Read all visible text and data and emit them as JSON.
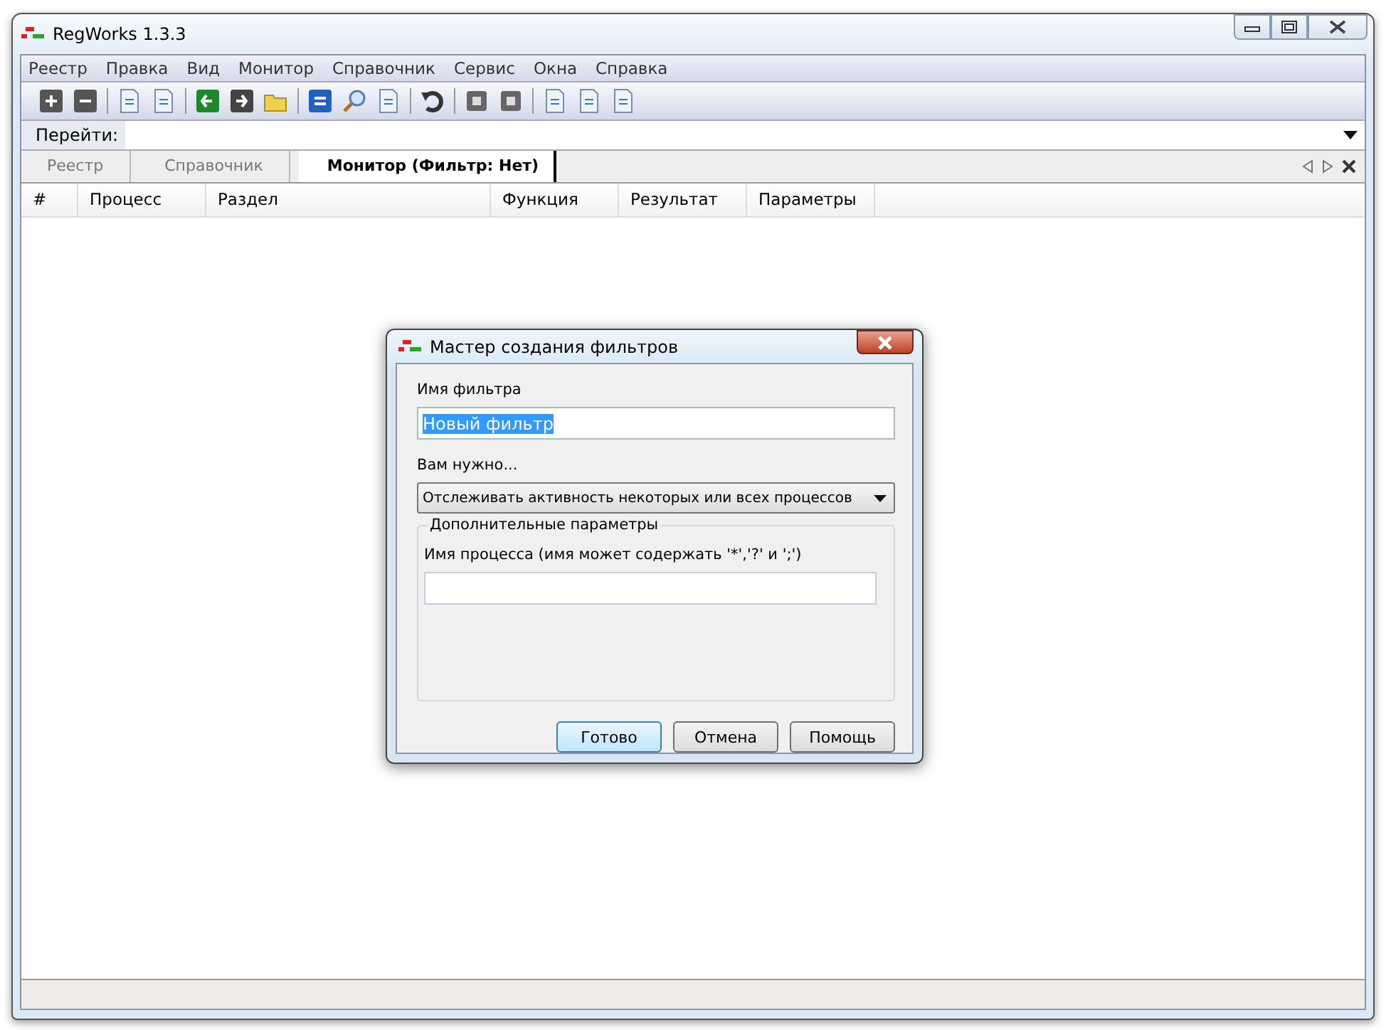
{
  "window": {
    "title": "RegWorks 1.3.3"
  },
  "menu": [
    "Реестр",
    "Правка",
    "Вид",
    "Монитор",
    "Справочник",
    "Сервис",
    "Окна",
    "Справка"
  ],
  "goto": {
    "label": "Перейти:"
  },
  "tabs": [
    {
      "label": "Реестр",
      "selected": false
    },
    {
      "label": "Справочник",
      "selected": false
    },
    {
      "label": "Монитор (Фильтр: Нет)",
      "selected": true
    }
  ],
  "table": {
    "columns": [
      "#",
      "Процесс",
      "Раздел",
      "Функция",
      "Результат",
      "Параметры"
    ]
  },
  "dialog": {
    "title": "Мастер создания фильтров",
    "name_label": "Имя фильтра",
    "name_value": "Новый фильтр",
    "name_value_selected": true,
    "mode_label": "Вам нужно...",
    "mode_value": "Отслеживать активность некоторых или всех процессов",
    "group_title": "Дополнительные параметры",
    "process_label": "Имя процесса (имя может содержать '*','?' и ';')",
    "buttons": [
      {
        "label": "Готово",
        "default": true
      },
      {
        "label": "Отмена",
        "default": false
      },
      {
        "label": "Помощь",
        "default": false
      }
    ]
  }
}
